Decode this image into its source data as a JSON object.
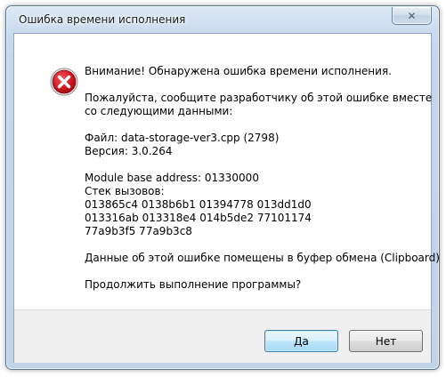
{
  "window": {
    "title": "Ошибка времени исполнения"
  },
  "icons": {
    "error": "error-icon",
    "close": "close-icon"
  },
  "colors": {
    "error_red": "#c8101a",
    "default_button_border": "#3c7fb1"
  },
  "message": {
    "headline": "Внимание! Обнаружена ошибка времени исполнения.",
    "request_line1": "Пожалуйста, сообщите разработчику об этой ошибке вместе",
    "request_line2": "со следующими данными:",
    "file": "Файл: data-storage-ver3.cpp (2798)",
    "version": "Версия: 3.0.264",
    "module_base": "Module base address: 01330000",
    "call_stack_label": "Стек вызовов:",
    "stack_line1": "013865c4 0138b6b1 01394778 013dd1d0",
    "stack_line2": "013316ab 013318e4 014b5de2 77101174",
    "stack_line3": "77a9b3f5 77a9b3c8",
    "clipboard_note": "Данные об этой ошибке помещены в буфер обмена (Clipboard)",
    "question": "Продолжить выполнение программы?"
  },
  "buttons": {
    "yes_label": "Да",
    "no_label": "Нет"
  }
}
